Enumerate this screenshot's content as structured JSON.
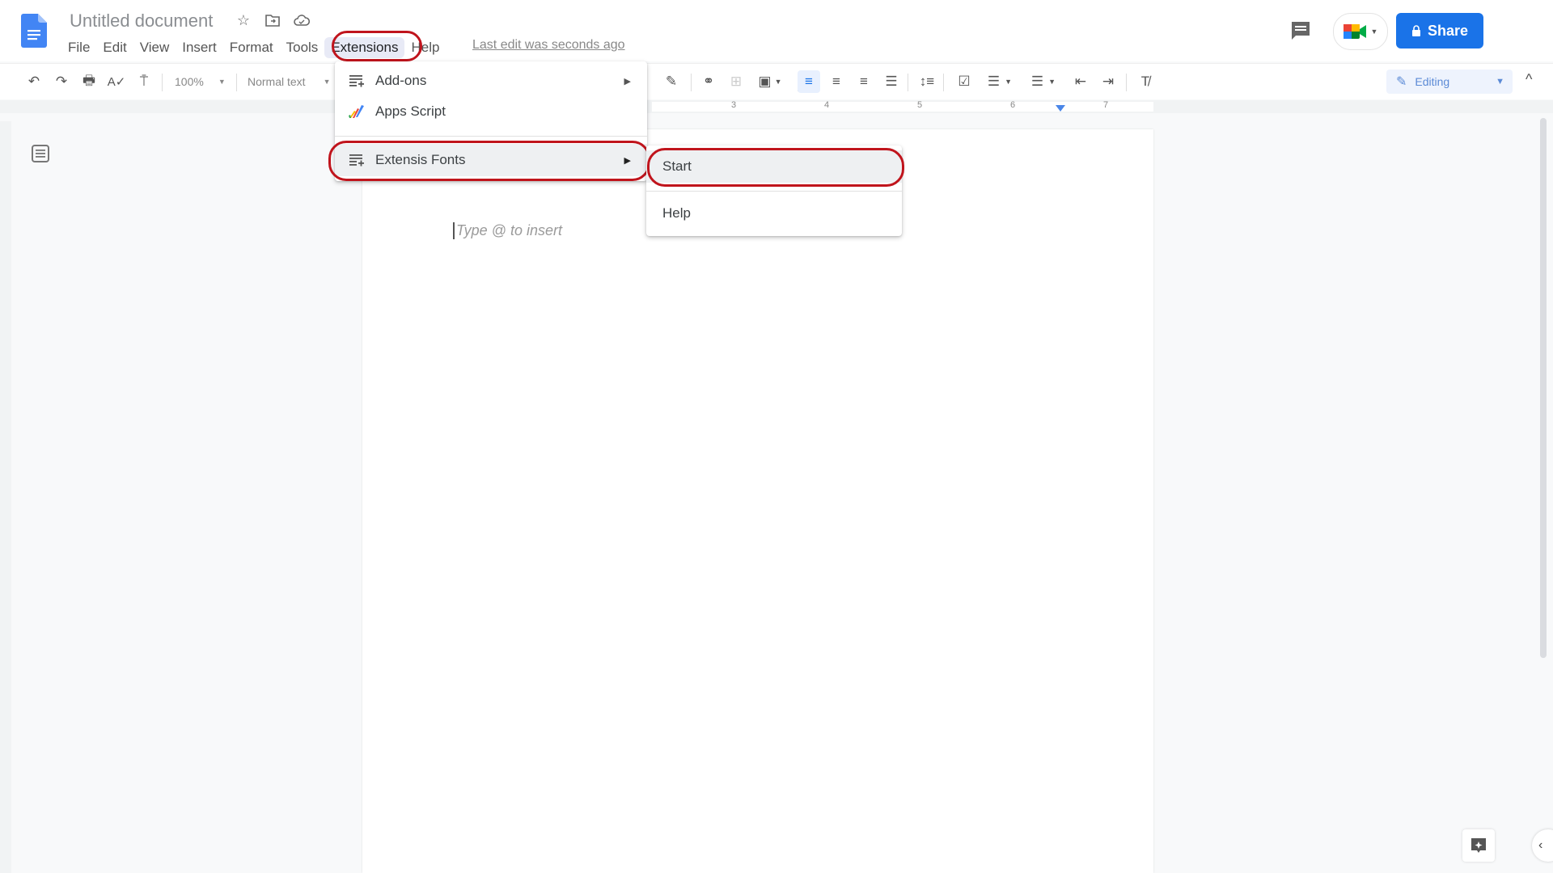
{
  "header": {
    "doc_title": "Untitled document",
    "title_icons": [
      "star-icon",
      "move-to-folder-icon",
      "cloud-status-icon"
    ],
    "menus": [
      "File",
      "Edit",
      "View",
      "Insert",
      "Format",
      "Tools",
      "Extensions",
      "Help"
    ],
    "active_menu": "Extensions",
    "last_edit": "Last edit was seconds ago",
    "share_label": "Share"
  },
  "toolbar": {
    "zoom": "100%",
    "style": "Normal text",
    "mode": "Editing"
  },
  "ruler": {
    "numbers": [
      "3",
      "4",
      "5",
      "6",
      "7"
    ]
  },
  "document": {
    "placeholder": "Type @ to insert"
  },
  "extensions_menu": {
    "items": [
      {
        "label": "Add-ons",
        "icon": "add-ons-icon",
        "has_submenu": true
      },
      {
        "label": "Apps Script",
        "icon": "apps-script-icon",
        "has_submenu": false
      },
      {
        "label": "Extensis Fonts",
        "icon": "extensis-fonts-icon",
        "has_submenu": true,
        "highlighted": true
      }
    ]
  },
  "submenu": {
    "items": [
      {
        "label": "Start",
        "highlighted": true
      },
      {
        "label": "Help"
      }
    ]
  },
  "colors": {
    "accent": "#1a73e8",
    "annotation_ring": "#c0141c"
  }
}
